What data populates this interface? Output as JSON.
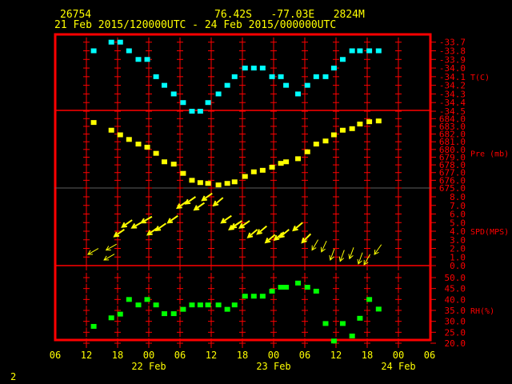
{
  "header": {
    "station_id": "26754",
    "location": "76.42S   -77.03E   2824M",
    "period": "21 Feb 2015/120000UTC - 24 Feb 2015/000000UTC"
  },
  "footer": {
    "page_number": "2"
  },
  "colors": {
    "frame": "#ff0000",
    "text": "#ffff00",
    "temperature": "#00ffff",
    "pressure": "#ffff00",
    "wind": "#ffff00",
    "rh": "#00ff00",
    "divider": "#606060"
  },
  "chart_data": [
    {
      "type": "scatter",
      "name": "temperature",
      "axis_label": "T(C)",
      "ticks": [
        "-33.7",
        "-33.8",
        "-33.9",
        "-34.0",
        "-34.1",
        "-34.2",
        "-34.3",
        "-34.4",
        "-34.5"
      ],
      "ylim": [
        -34.5,
        -33.7
      ],
      "x_units": "hours since 21 Feb 12UTC",
      "x": [
        1.4,
        4.8,
        6.5,
        8.2,
        10,
        11.7,
        13.4,
        15,
        16.8,
        18.6,
        20.3,
        21.9,
        23.4,
        25.4,
        27.1,
        28.5,
        30.5,
        32.2,
        33.9,
        35.7,
        37.4,
        38.4,
        40.7,
        42.5,
        44.2,
        46,
        47.6,
        49.3,
        51.1,
        52.6,
        54.4,
        56.2
      ],
      "y": [
        -33.8,
        -33.7,
        -33.7,
        -33.8,
        -33.9,
        -33.9,
        -34.1,
        -34.2,
        -34.3,
        -34.4,
        -34.5,
        -34.5,
        -34.4,
        -34.3,
        -34.2,
        -34.1,
        -34.0,
        -34.0,
        -34.0,
        -34.1,
        -34.1,
        -34.2,
        -34.3,
        -34.2,
        -34.1,
        -34.1,
        -34.0,
        -33.9,
        -33.8,
        -33.8,
        -33.8,
        -33.8
      ]
    },
    {
      "type": "scatter",
      "name": "pressure",
      "axis_label": "Pre (mb)",
      "ticks": [
        "684.0",
        "683.0",
        "682.0",
        "681.0",
        "680.0",
        "679.0",
        "678.0",
        "677.0",
        "676.0",
        "675.0"
      ],
      "ylim": [
        675,
        684
      ],
      "x": [
        1.4,
        4.8,
        6.5,
        8.2,
        10,
        11.7,
        13.4,
        15,
        16.8,
        18.6,
        20.3,
        21.9,
        23.4,
        25.4,
        27.1,
        28.5,
        30.5,
        32.2,
        33.9,
        35.7,
        37.4,
        38.4,
        40.7,
        42.5,
        44.2,
        46,
        47.6,
        49.3,
        51.1,
        52.6,
        54.4,
        56.2
      ],
      "y": [
        683.5,
        682.5,
        681.9,
        681.3,
        680.7,
        680.3,
        679.5,
        678.4,
        678.1,
        676.9,
        676.0,
        675.7,
        675.6,
        675.4,
        675.6,
        675.8,
        676.5,
        677.1,
        677.3,
        677.7,
        678.2,
        678.4,
        678.8,
        679.7,
        680.7,
        681.1,
        681.9,
        682.5,
        682.7,
        683.3,
        683.6,
        683.7
      ]
    },
    {
      "type": "scatter",
      "name": "wind_speed",
      "axis_label": "SPD(MPS)",
      "ticks": [
        "8.0",
        "7.0",
        "6.0",
        "5.0",
        "4.0",
        "3.0",
        "2.0",
        "1.0",
        "0.0"
      ],
      "ylim": [
        0,
        8
      ],
      "x": [
        0.3,
        3.4,
        3.8,
        5.4,
        6.9,
        8.8,
        10.6,
        11.8,
        13.4,
        15.7,
        17.5,
        19.1,
        20.8,
        22.3,
        24.5,
        26,
        27.5,
        28,
        29.5,
        31.1,
        32.9,
        34.5,
        36.2,
        37.2,
        39.8,
        41.5,
        43.4,
        45.2,
        46.9,
        48.8,
        50.6,
        52.3,
        53.4,
        55.4
      ],
      "y": [
        1.3,
        0.65,
        1.8,
        3.4,
        4.5,
        4.4,
        5.0,
        3.6,
        4.1,
        5.0,
        6.7,
        7.2,
        6.5,
        7.6,
        7.0,
        5.0,
        4.2,
        4.4,
        4.4,
        3.3,
        3.7,
        2.7,
        3.0,
        3.3,
        4.1,
        2.7,
        1.8,
        1.6,
        0.65,
        0.5,
        0.8,
        0.2,
        0.1,
        1.3
      ],
      "direction_to_deg": [
        240,
        240,
        240,
        235,
        235,
        240,
        240,
        235,
        235,
        235,
        235,
        235,
        235,
        235,
        230,
        235,
        235,
        235,
        235,
        230,
        230,
        230,
        230,
        230,
        230,
        225,
        210,
        205,
        200,
        200,
        200,
        200,
        210,
        215
      ]
    },
    {
      "type": "scatter",
      "name": "relative_humidity",
      "axis_label": "RH(%)",
      "ticks": [
        "50.0",
        "45.0",
        "40.0",
        "35.0",
        "30.0",
        "25.0",
        "20.0"
      ],
      "ylim": [
        20,
        50
      ],
      "x": [
        1.4,
        4.8,
        6.5,
        8.2,
        10,
        11.7,
        13.4,
        15,
        16.8,
        18.6,
        20.3,
        21.9,
        23.4,
        25.4,
        27.1,
        28.5,
        30.5,
        32.2,
        33.9,
        35.7,
        37.4,
        38.4,
        40.7,
        42.5,
        44.2,
        46,
        47.6,
        49.3,
        51.1,
        52.6,
        54.4,
        56.2
      ],
      "y": [
        27.7,
        31.6,
        33.3,
        40,
        37.5,
        40,
        37.5,
        33.5,
        33.5,
        35.5,
        37.5,
        37.5,
        37.5,
        37.5,
        35.5,
        37.5,
        41.5,
        41.5,
        41.5,
        43.8,
        45.6,
        45.6,
        47.5,
        45.6,
        43.8,
        29,
        21,
        29,
        23.3,
        31.4,
        40,
        35.6
      ]
    }
  ],
  "x_axis": {
    "hour_ticks": [
      "06",
      "12",
      "18",
      "00",
      "06",
      "12",
      "18",
      "00",
      "06",
      "12",
      "18",
      "00",
      "06"
    ],
    "date_labels": [
      "22 Feb",
      "23 Feb",
      "24 Feb"
    ]
  }
}
